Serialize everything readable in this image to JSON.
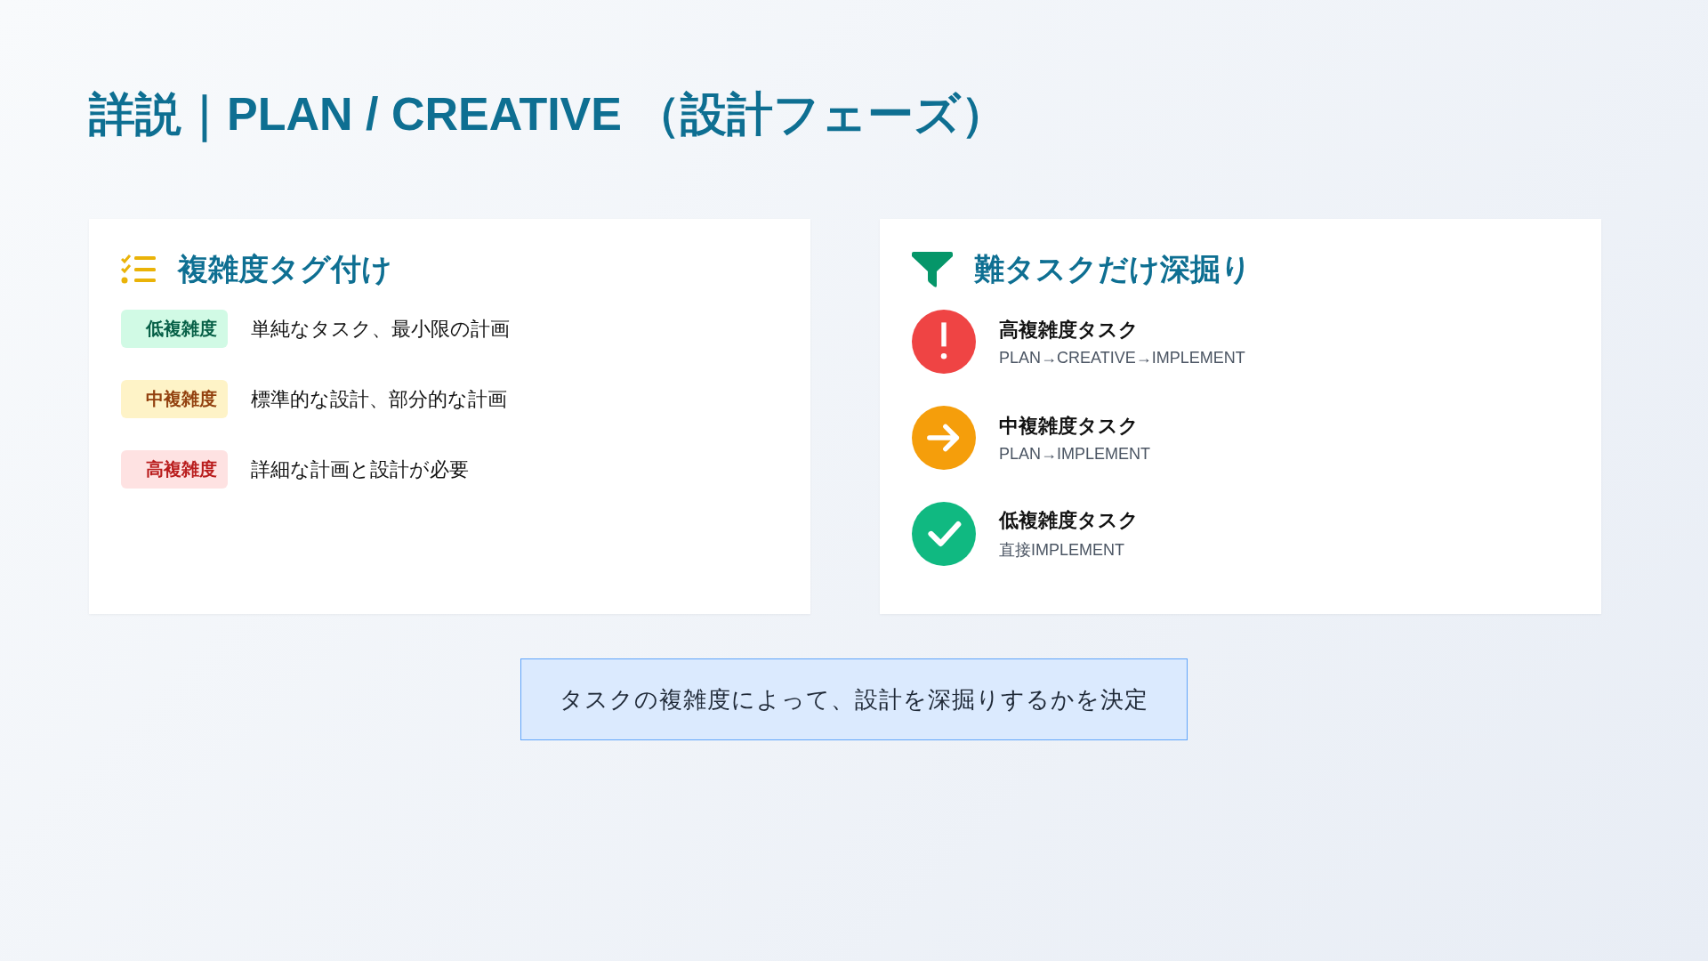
{
  "title": "詳説｜PLAN / CREATIVE （設計フェーズ）",
  "left_card": {
    "heading": "複雑度タグ付け",
    "items": [
      {
        "kind": "low",
        "tag": "低複雑度",
        "text": "単純なタスク、最小限の計画"
      },
      {
        "kind": "mid",
        "tag": "中複雑度",
        "text": "標準的な設計、部分的な計画"
      },
      {
        "kind": "high",
        "tag": "高複雑度",
        "text": "詳細な計画と設計が必要"
      }
    ]
  },
  "right_card": {
    "heading": "難タスクだけ深掘り",
    "items": [
      {
        "kind": "high",
        "color": "#ef4444",
        "title": "高複雑度タスク",
        "flow": "PLAN→CREATIVE→IMPLEMENT"
      },
      {
        "kind": "mid",
        "color": "#f59e0b",
        "title": "中複雑度タスク",
        "flow": "PLAN→IMPLEMENT"
      },
      {
        "kind": "low",
        "color": "#10b981",
        "title": "低複雑度タスク",
        "flow": "直接IMPLEMENT"
      }
    ]
  },
  "note": "タスクの複雑度によって、設計を深掘りするかを決定"
}
